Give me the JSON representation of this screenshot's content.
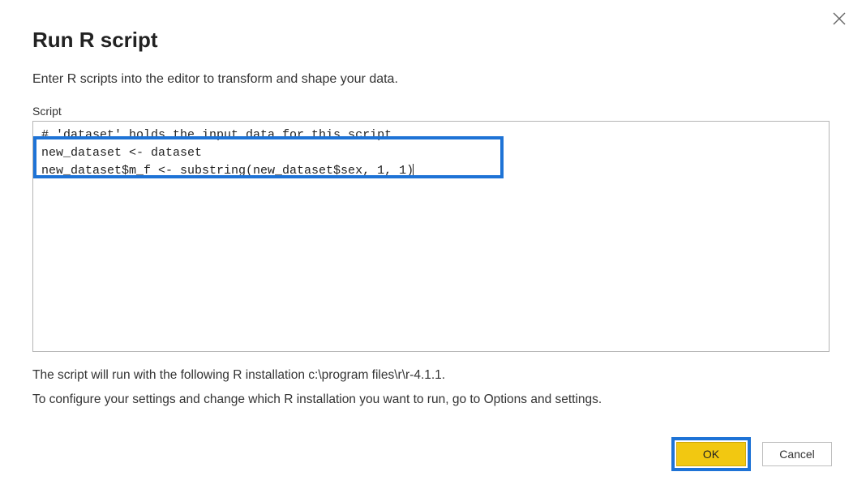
{
  "dialog": {
    "title": "Run R script",
    "subtitle": "Enter R scripts into the editor to transform and shape your data.",
    "scriptLabel": "Script",
    "scriptLines": [
      "# 'dataset' holds the input data for this script",
      "new_dataset <- dataset",
      "new_dataset$m_f <- substring(new_dataset$sex, 1, 1)"
    ],
    "info1": "The script will run with the following R installation c:\\program files\\r\\r-4.1.1.",
    "info2": "To configure your settings and change which R installation you want to run, go to Options and settings.",
    "okLabel": "OK",
    "cancelLabel": "Cancel"
  }
}
